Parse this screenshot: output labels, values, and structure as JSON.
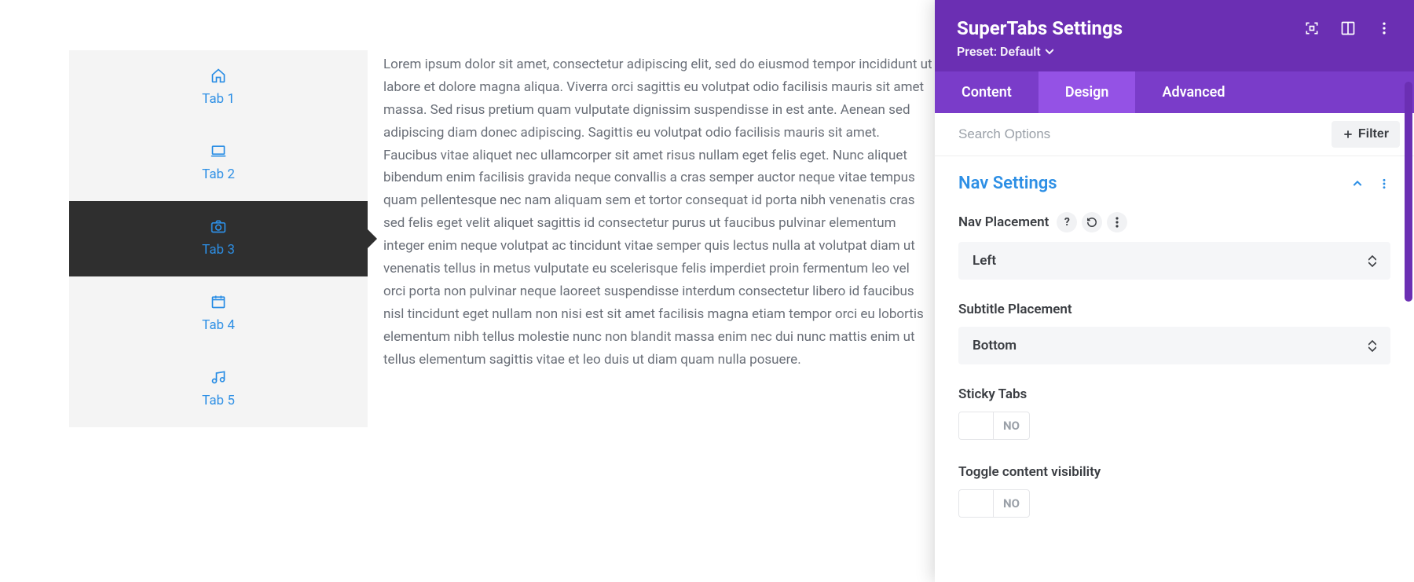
{
  "preview": {
    "tabs": [
      {
        "label": "Tab 1",
        "icon": "home-icon",
        "active": false
      },
      {
        "label": "Tab 2",
        "icon": "laptop-icon",
        "active": false
      },
      {
        "label": "Tab 3",
        "icon": "camera-icon",
        "active": true
      },
      {
        "label": "Tab 4",
        "icon": "calendar-icon",
        "active": false
      },
      {
        "label": "Tab 5",
        "icon": "music-icon",
        "active": false
      }
    ],
    "content": "Lorem ipsum dolor sit amet, consectetur adipiscing elit, sed do eiusmod tempor incididunt ut labore et dolore magna aliqua. Viverra orci sagittis eu volutpat odio facilisis mauris sit amet massa. Sed risus pretium quam vulputate dignissim suspendisse in est ante. Aenean sed adipiscing diam donec adipiscing. Sagittis eu volutpat odio facilisis mauris sit amet. Faucibus vitae aliquet nec ullamcorper sit amet risus nullam eget felis eget. Nunc aliquet bibendum enim facilisis gravida neque convallis a cras semper auctor neque vitae tempus quam pellentesque nec nam aliquam sem et tortor consequat id porta nibh venenatis cras sed felis eget velit aliquet sagittis id consectetur purus ut faucibus pulvinar elementum integer enim neque volutpat ac tincidunt vitae semper quis lectus nulla at volutpat diam ut venenatis tellus in metus vulputate eu scelerisque felis imperdiet proin fermentum leo vel orci porta non pulvinar neque laoreet suspendisse interdum consectetur libero id faucibus nisl tincidunt eget nullam non nisi est sit amet facilisis magna etiam tempor orci eu lobortis elementum nibh tellus molestie nunc non blandit massa enim nec dui nunc mattis enim ut tellus elementum sagittis vitae et leo duis ut diam quam nulla posuere."
  },
  "panel": {
    "title": "SuperTabs Settings",
    "preset_label": "Preset: Default",
    "tabs": [
      {
        "label": "Content",
        "active": false
      },
      {
        "label": "Design",
        "active": true
      },
      {
        "label": "Advanced",
        "active": false
      }
    ],
    "search_placeholder": "Search Options",
    "filter_label": "Filter",
    "section_title": "Nav Settings",
    "fields": {
      "nav_placement": {
        "label": "Nav Placement",
        "value": "Left",
        "show_icons": true
      },
      "subtitle_placement": {
        "label": "Subtitle Placement",
        "value": "Bottom",
        "show_icons": false
      },
      "sticky_tabs": {
        "label": "Sticky Tabs",
        "value": "NO"
      },
      "toggle_content": {
        "label": "Toggle content visibility",
        "value": "NO"
      }
    }
  }
}
